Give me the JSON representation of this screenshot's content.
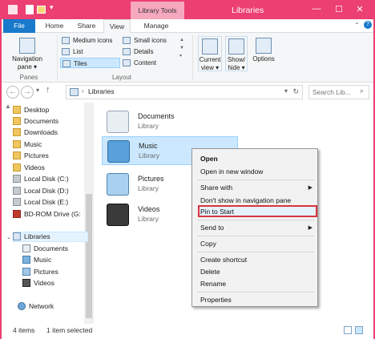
{
  "window": {
    "title": "Libraries",
    "context_tab_group": "Library Tools",
    "accent_color": "#ec3f72"
  },
  "tabs": {
    "file": "File",
    "home": "Home",
    "share": "Share",
    "view": "View",
    "manage": "Manage"
  },
  "ribbon": {
    "panes": {
      "navigation_pane_line1": "Navigation",
      "navigation_pane_line2": "pane ▾",
      "label": "Panes"
    },
    "layout": {
      "medium_icons": "Medium icons",
      "small_icons": "Small icons",
      "list": "List",
      "details": "Details",
      "tiles": "Tiles",
      "content": "Content",
      "label": "Layout"
    },
    "current_view": {
      "line1": "Current",
      "line2": "view ▾"
    },
    "show_hide": {
      "line1": "Show/",
      "line2": "hide ▾"
    },
    "options": "Options"
  },
  "address": {
    "back_icon": "left-arrow",
    "forward_icon": "right-arrow",
    "path_root": "Libraries",
    "search_placeholder": "Search Lib..."
  },
  "nav_pane": {
    "items": [
      {
        "label": "Desktop",
        "icon": "folder"
      },
      {
        "label": "Documents",
        "icon": "folder"
      },
      {
        "label": "Downloads",
        "icon": "folder"
      },
      {
        "label": "Music",
        "icon": "folder"
      },
      {
        "label": "Pictures",
        "icon": "folder"
      },
      {
        "label": "Videos",
        "icon": "folder"
      },
      {
        "label": "Local Disk (C:)",
        "icon": "drive"
      },
      {
        "label": "Local Disk (D:)",
        "icon": "drive"
      },
      {
        "label": "Local Disk (E:)",
        "icon": "drive"
      },
      {
        "label": "BD-ROM Drive (G:",
        "icon": "optical-drive"
      },
      {
        "label": "Libraries",
        "icon": "library"
      },
      {
        "label": "Documents",
        "icon": "library"
      },
      {
        "label": "Music",
        "icon": "library"
      },
      {
        "label": "Pictures",
        "icon": "library"
      },
      {
        "label": "Videos",
        "icon": "library"
      },
      {
        "label": "Network",
        "icon": "network"
      }
    ]
  },
  "libraries": [
    {
      "name": "Documents",
      "type": "Library"
    },
    {
      "name": "Music",
      "type": "Library"
    },
    {
      "name": "Pictures",
      "type": "Library"
    },
    {
      "name": "Videos",
      "type": "Library"
    }
  ],
  "status": {
    "item_count": "4 items",
    "selection": "1 item selected"
  },
  "context_menu": {
    "open": "Open",
    "open_new_window": "Open in new window",
    "share_with": "Share with",
    "dont_show": "Don't show in navigation pane",
    "pin_to_start": "Pin to Start",
    "send_to": "Send to",
    "copy": "Copy",
    "create_shortcut": "Create shortcut",
    "delete": "Delete",
    "rename": "Rename",
    "properties": "Properties"
  }
}
